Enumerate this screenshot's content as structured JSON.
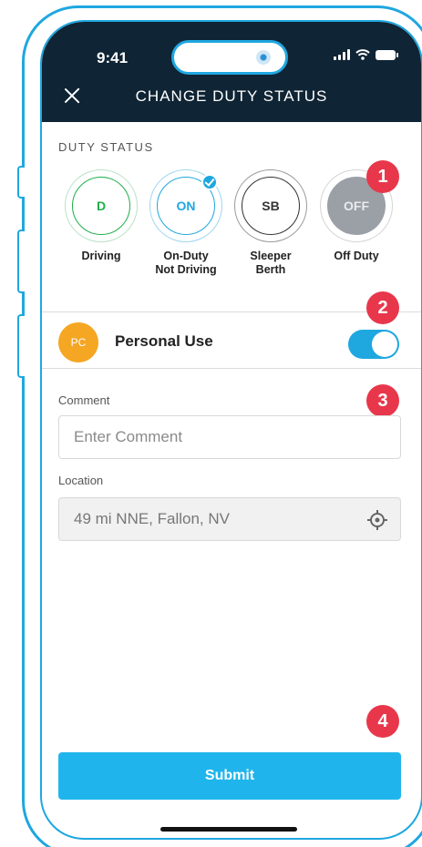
{
  "status_bar": {
    "time": "9:41"
  },
  "header": {
    "title": "CHANGE DUTY STATUS"
  },
  "duty_status": {
    "section_label": "DUTY STATUS",
    "options": [
      {
        "code": "D",
        "label": "Driving",
        "color": "#1fae4b",
        "selected": false
      },
      {
        "code": "ON",
        "label": "On-Duty\nNot Driving",
        "color": "#1fa7e0",
        "selected": true
      },
      {
        "code": "SB",
        "label": "Sleeper\nBerth",
        "color": "#333333",
        "selected": false
      },
      {
        "code": "OFF",
        "label": "Off Duty",
        "color": "#9aa0a6",
        "selected": false
      }
    ]
  },
  "markers": [
    "1",
    "2",
    "3",
    "4"
  ],
  "personal_use": {
    "avatar": "PC",
    "label": "Personal Use",
    "enabled": true
  },
  "comment": {
    "label": "Comment",
    "placeholder": "Enter Comment",
    "value": ""
  },
  "location": {
    "label": "Location",
    "value": "49 mi NNE, Fallon, NV"
  },
  "submit": {
    "label": "Submit"
  },
  "colors": {
    "accent": "#1fa7e0",
    "header_bg": "#0f2434",
    "marker": "#e8374b",
    "pc_avatar": "#f5a623"
  }
}
